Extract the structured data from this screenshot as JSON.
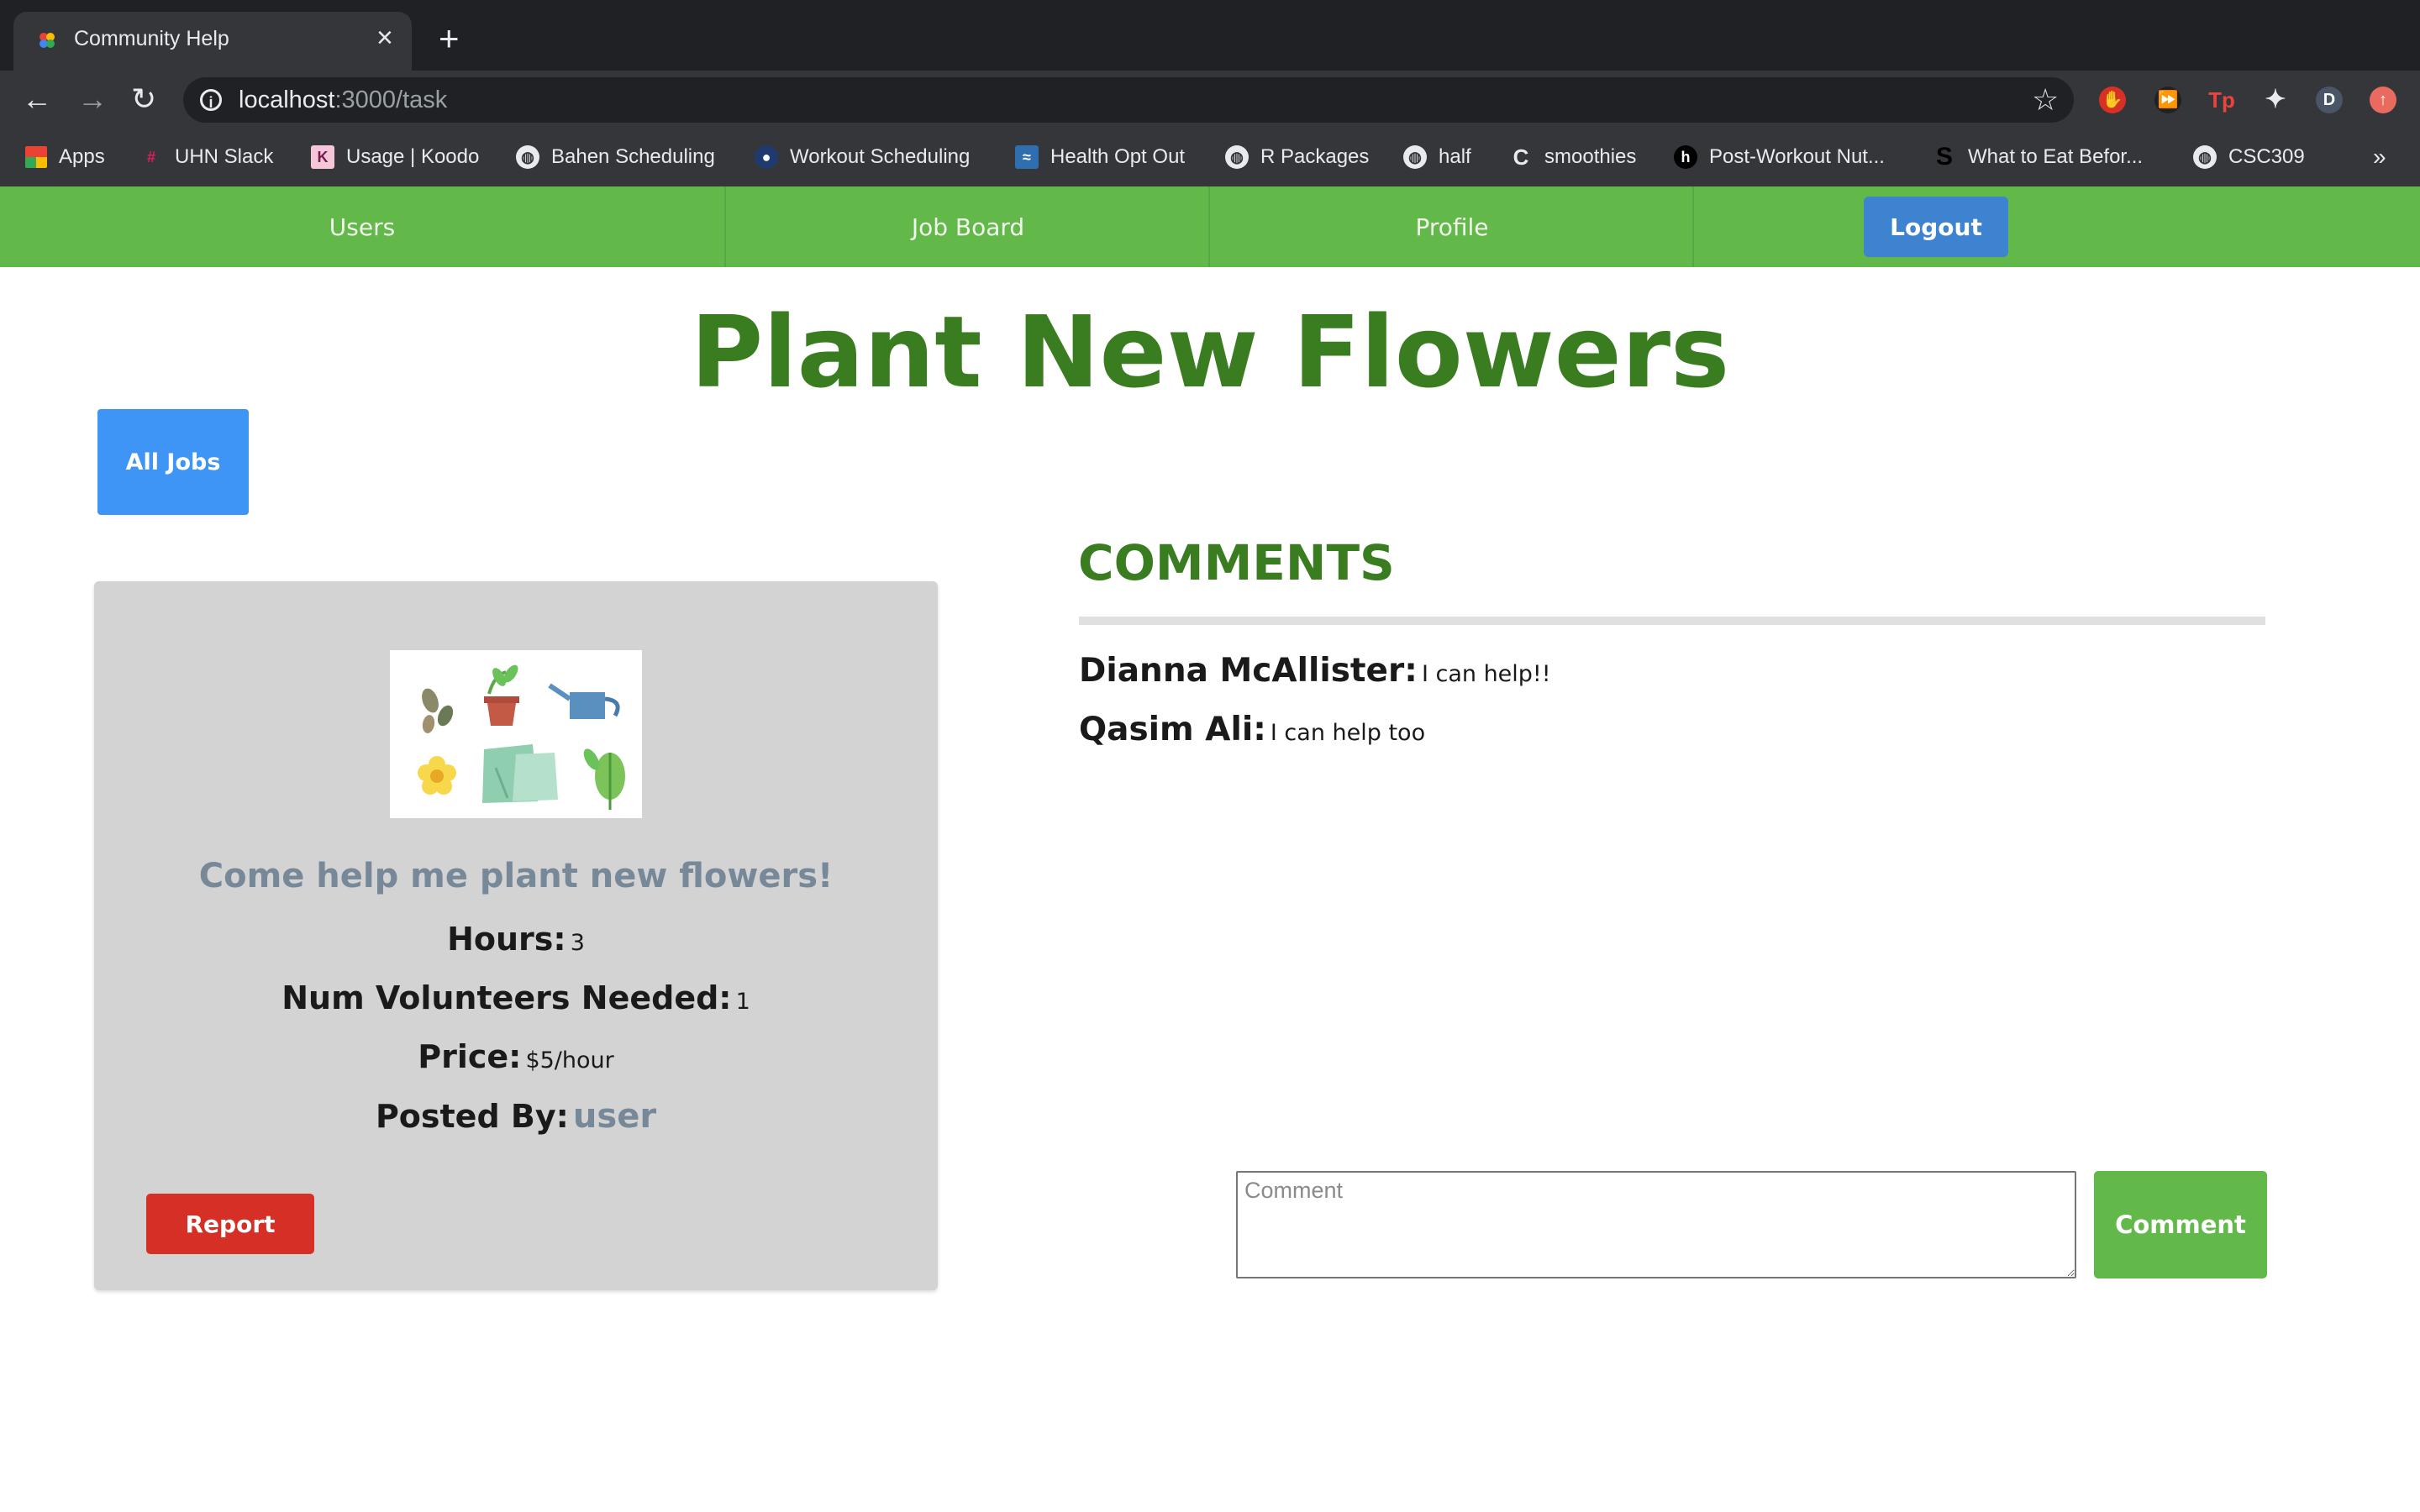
{
  "browser": {
    "tab_title": "Community Help",
    "url_host": "localhost",
    "url_path": ":3000/task",
    "bookmarks": [
      {
        "label": "Apps",
        "icon": "apps-grid-icon"
      },
      {
        "label": "UHN Slack",
        "icon": "slack-icon"
      },
      {
        "label": "Usage | Koodo",
        "icon": "koodo-icon"
      },
      {
        "label": "Bahen Scheduling",
        "icon": "globe-icon"
      },
      {
        "label": "Workout Scheduling",
        "icon": "workout-icon"
      },
      {
        "label": "Health Opt Out",
        "icon": "health-icon"
      },
      {
        "label": "R Packages",
        "icon": "globe-icon"
      },
      {
        "label": "half",
        "icon": "globe-icon"
      },
      {
        "label": "smoothies",
        "icon": "c-icon"
      },
      {
        "label": "Post-Workout Nut...",
        "icon": "h-icon"
      },
      {
        "label": "What to Eat Befor...",
        "icon": "s-icon"
      },
      {
        "label": "CSC309",
        "icon": "globe-icon"
      }
    ],
    "overflow": "»",
    "profile_initial": "D"
  },
  "nav": {
    "users": "Users",
    "job_board": "Job Board",
    "profile": "Profile",
    "logout": "Logout"
  },
  "page": {
    "title": "Plant New Flowers",
    "all_jobs": "All Jobs"
  },
  "job": {
    "description": "Come help me plant new flowers!",
    "hours_label": "Hours:",
    "hours_value": "3",
    "volunteers_label": "Num Volunteers Needed:",
    "volunteers_value": "1",
    "price_label": "Price:",
    "price_value": "$5/hour",
    "posted_label": "Posted By:",
    "posted_value": "user",
    "report": "Report"
  },
  "comments": {
    "heading": "COMMENTS",
    "items": [
      {
        "author": "Dianna McAllister:",
        "text": "I can help!!"
      },
      {
        "author": "Qasim Ali:",
        "text": "I can help too"
      }
    ],
    "input_placeholder": "Comment",
    "submit": "Comment"
  },
  "colors": {
    "navbar": "#62b94a",
    "title_green": "#3a7d21",
    "logout_blue": "#3d83cf",
    "all_jobs_blue": "#3f95f6",
    "report_red": "#d63026"
  }
}
